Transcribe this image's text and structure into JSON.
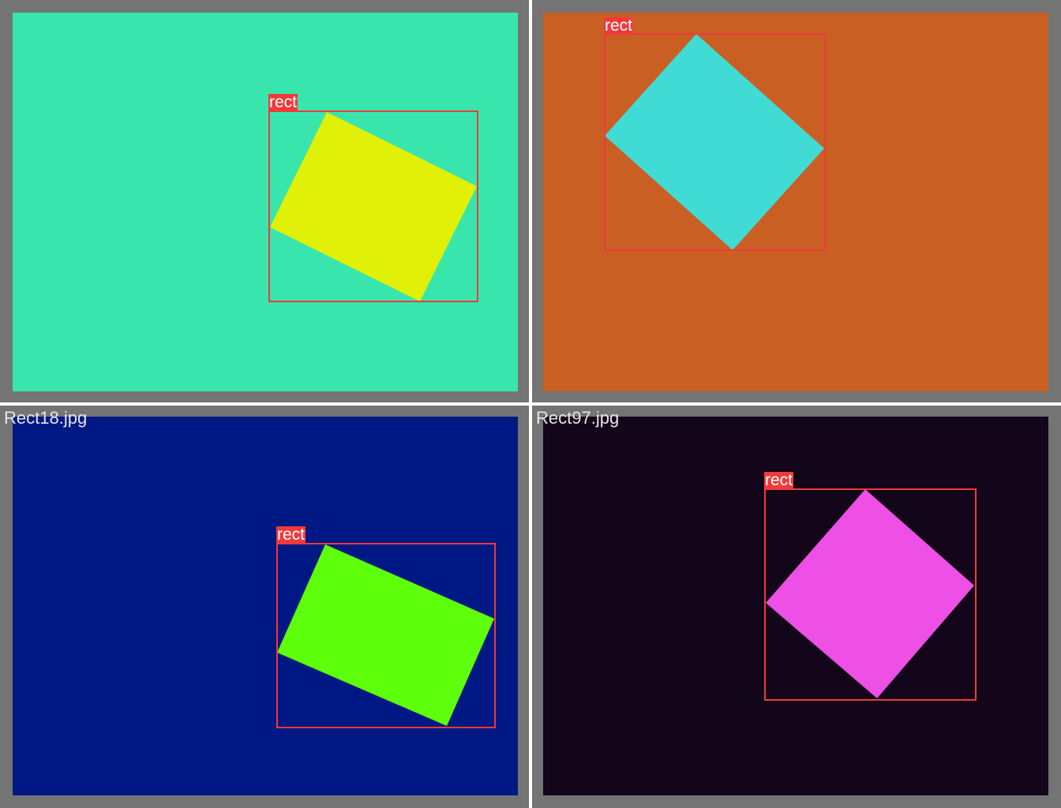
{
  "tiles": [
    {
      "filename": "",
      "background_color": "#38e6ad",
      "shape_color": "#e1f007",
      "label": "rect"
    },
    {
      "filename": "",
      "background_color": "#c95f22",
      "shape_color": "#41dbd6",
      "label": "rect"
    },
    {
      "filename": "Rect18.jpg",
      "background_color": "#001883",
      "shape_color": "#5dff0a",
      "label": "rect"
    },
    {
      "filename": "Rect97.jpg",
      "background_color": "#13051a",
      "shape_color": "#ee4fe4",
      "label": "rect"
    }
  ],
  "box_color": "#f03a3a"
}
